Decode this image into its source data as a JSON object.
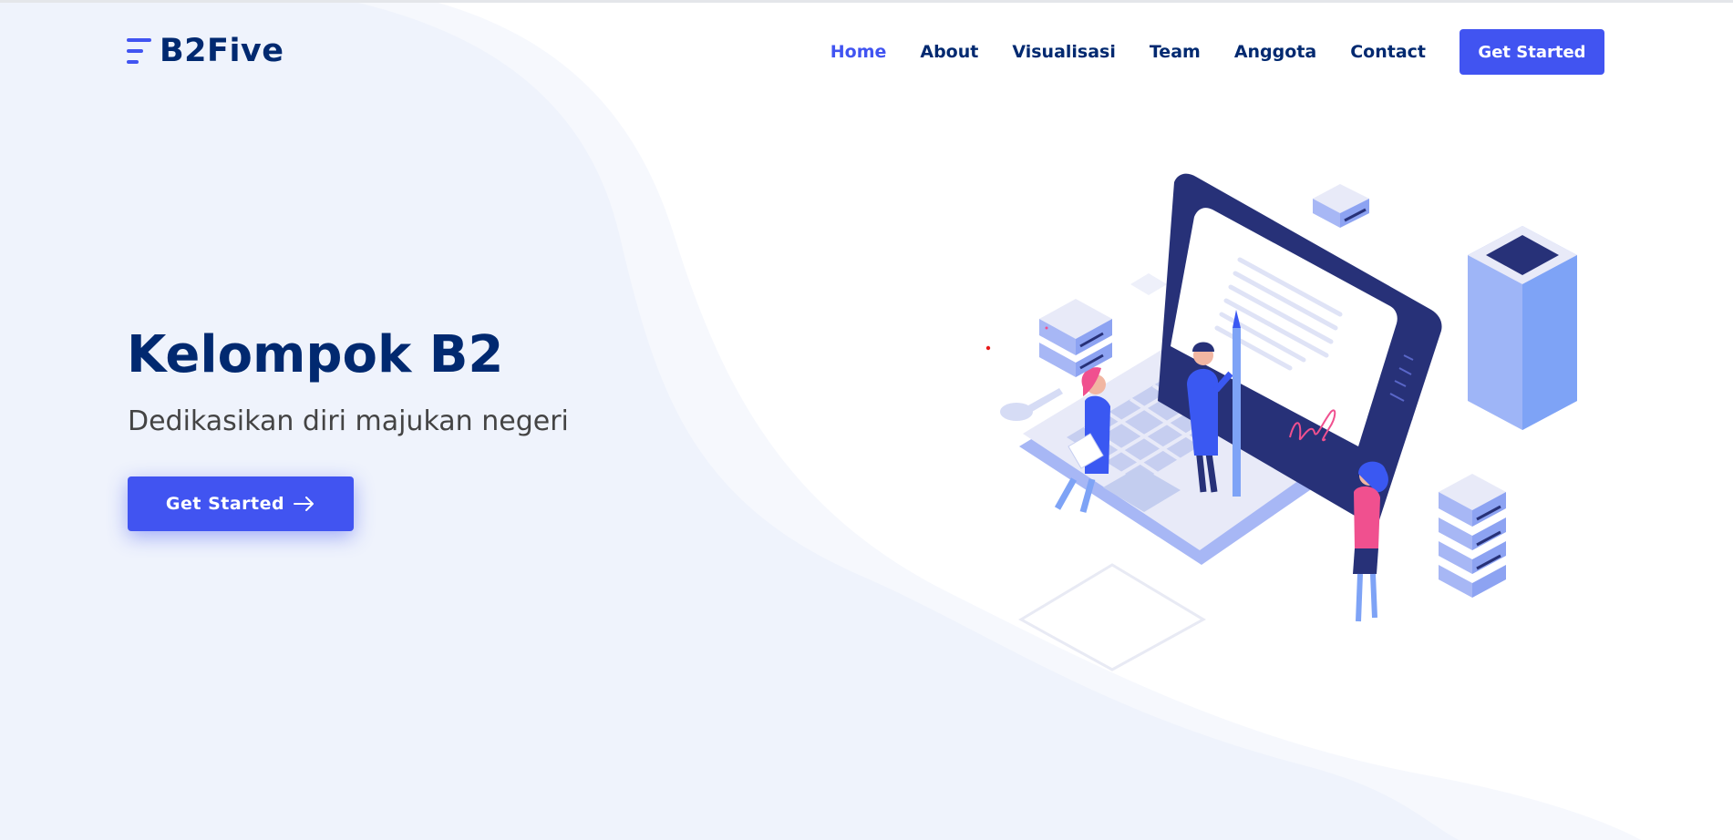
{
  "page": {
    "title": "B2Five"
  },
  "header": {
    "logo_text": "B2Five",
    "logo_icon": "bars-icon",
    "nav": [
      {
        "label": "Home",
        "active": true
      },
      {
        "label": "About",
        "active": false
      },
      {
        "label": "Visualisasi",
        "active": false
      },
      {
        "label": "Team",
        "active": false
      },
      {
        "label": "Anggota",
        "active": false
      },
      {
        "label": "Contact",
        "active": false
      }
    ],
    "cta_label": "Get Started"
  },
  "hero": {
    "title": "Kelompok B2",
    "subtitle": "Dedikasikan diri majukan negeri",
    "button_label": "Get Started",
    "button_icon": "arrow-right-icon",
    "illustration": "isometric-laptop-team-illustration"
  },
  "colors": {
    "primary": "#4154f1",
    "heading": "#012970",
    "text": "#444444",
    "hero_bg": "#f0f3fc",
    "hero_bg_light": "#f6f8fd"
  }
}
